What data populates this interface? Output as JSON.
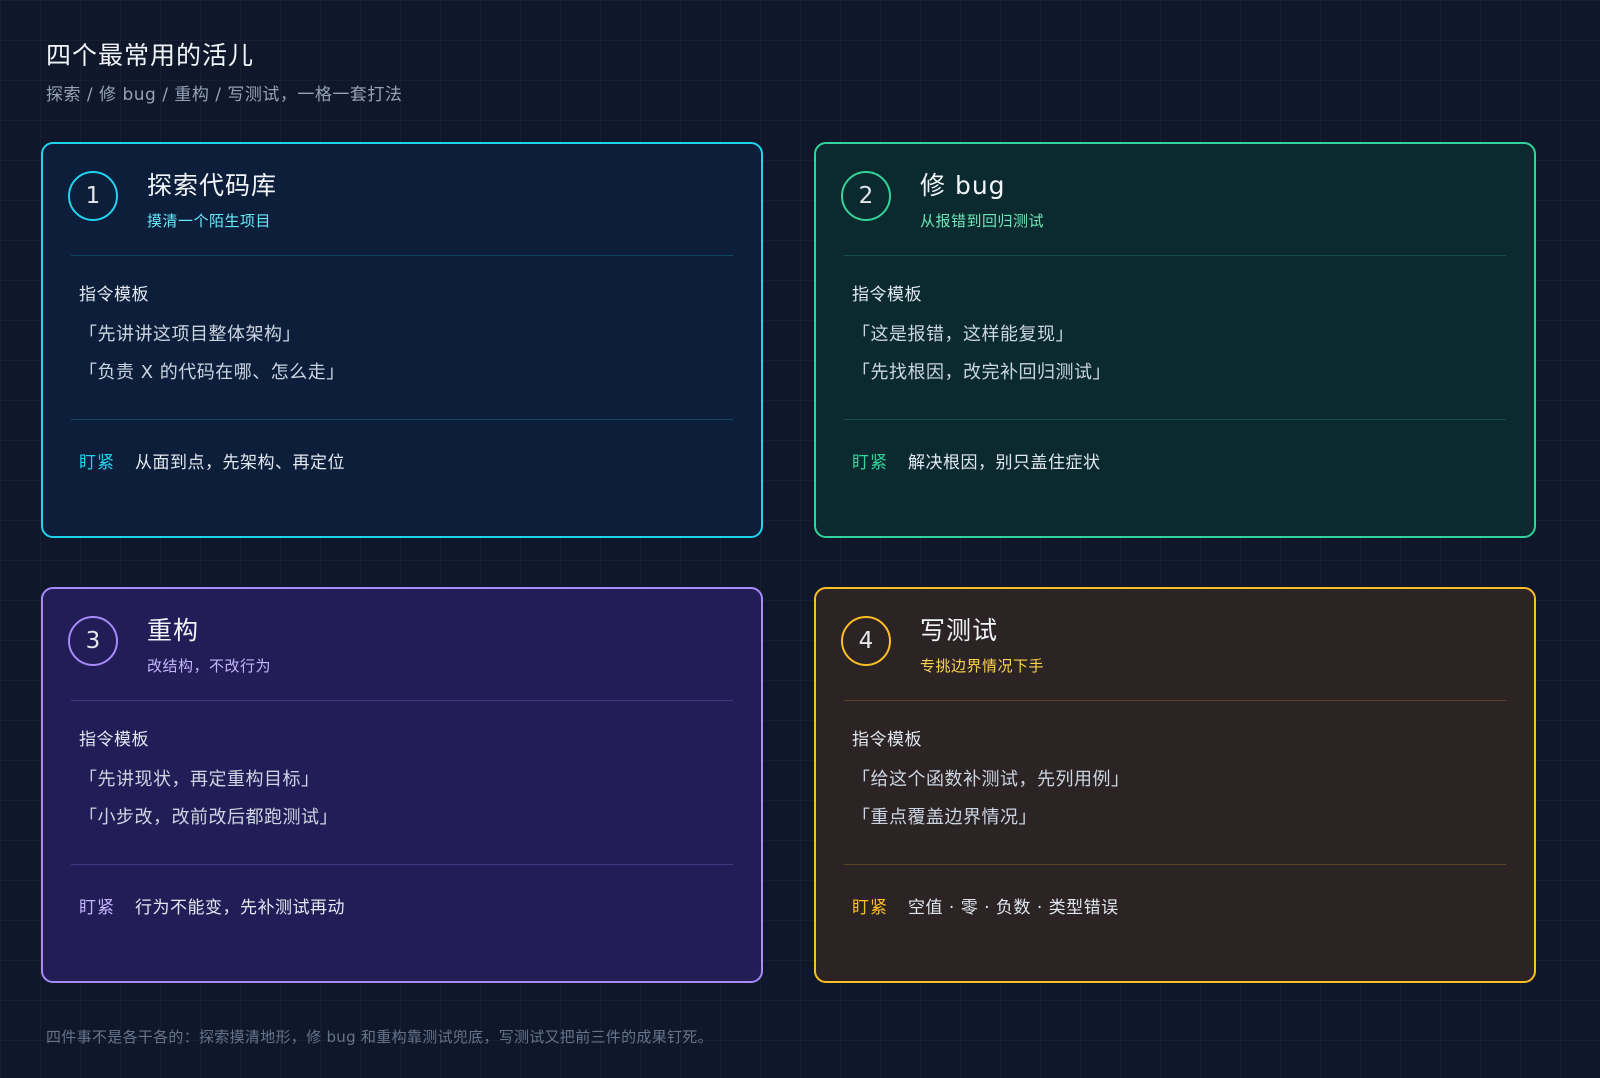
{
  "header": {
    "title": "四个最常用的活儿",
    "subtitle": "探索 / 修 bug / 重构 / 写测试，一格一套打法"
  },
  "cards": [
    {
      "number": "1",
      "title": "探索代码库",
      "subtitle": "摸清一个陌生项目",
      "section_label": "指令模板",
      "prompts": [
        "「先讲讲这项目整体架构」",
        "「负责 X 的代码在哪、怎么走」"
      ],
      "focus_label": "盯紧",
      "focus_text": "从面到点，先架构、再定位",
      "accent_color": "#22d3ee"
    },
    {
      "number": "2",
      "title": "修 bug",
      "subtitle": "从报错到回归测试",
      "section_label": "指令模板",
      "prompts": [
        "「这是报错，这样能复现」",
        "「先找根因，改完补回归测试」"
      ],
      "focus_label": "盯紧",
      "focus_text": "解决根因，别只盖住症状",
      "accent_color": "#34d399"
    },
    {
      "number": "3",
      "title": "重构",
      "subtitle": "改结构，不改行为",
      "section_label": "指令模板",
      "prompts": [
        "「先讲现状，再定重构目标」",
        "「小步改，改前改后都跑测试」"
      ],
      "focus_label": "盯紧",
      "focus_text": "行为不能变，先补测试再动",
      "accent_color": "#a78bfa"
    },
    {
      "number": "4",
      "title": "写测试",
      "subtitle": "专挑边界情况下手",
      "section_label": "指令模板",
      "prompts": [
        "「给这个函数补测试，先列用例」",
        "「重点覆盖边界情况」"
      ],
      "focus_label": "盯紧",
      "focus_text": "空值 · 零 · 负数 · 类型错误",
      "accent_color": "#fbbf24"
    }
  ],
  "footer": {
    "text": "四件事不是各干各的：探索摸清地形，修 bug 和重构靠测试兜底，写测试又把前三件的成果钉死。"
  }
}
